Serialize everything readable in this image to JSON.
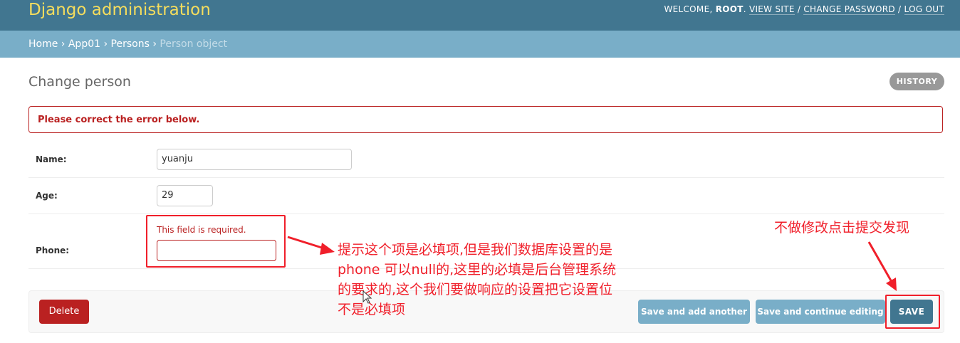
{
  "header": {
    "site_title": "Django administration",
    "welcome": "WELCOME,",
    "username": "ROOT",
    "view_site": "VIEW SITE",
    "change_password": "CHANGE PASSWORD",
    "log_out": "LOG OUT",
    "separator": "/"
  },
  "breadcrumbs": {
    "home": "Home",
    "app": "App01",
    "model": "Persons",
    "current": "Person object",
    "separator": "›"
  },
  "page": {
    "title": "Change person",
    "history_label": "HISTORY",
    "error_note": "Please correct the error below."
  },
  "form": {
    "name": {
      "label": "Name:",
      "value": "yuanju"
    },
    "age": {
      "label": "Age:",
      "value": "29"
    },
    "phone": {
      "label": "Phone:",
      "value": "",
      "error": "This field is required."
    }
  },
  "actions": {
    "delete": "Delete",
    "save_add_another": "Save and add another",
    "save_continue": "Save and continue editing",
    "save": "SAVE"
  },
  "annotations": {
    "top_right_note": "不做修改点击提交发现",
    "phone_note_lines": [
      "提示这个项是必填项,但是我们数据库设置的是",
      "phone 可以null的,这里的必填是后台管理系统",
      "的要求的,这个我们要做响应的设置把它设置位",
      "不是必填项"
    ],
    "annotation_color": "#f01f2a"
  },
  "colors": {
    "header_bg": "#417690",
    "breadcrumb_bg": "#79aec8",
    "site_title": "#f5dd5d",
    "error_red": "#ba2121",
    "save_bg": "#417690",
    "secondary_btn_bg": "#79aec8"
  }
}
